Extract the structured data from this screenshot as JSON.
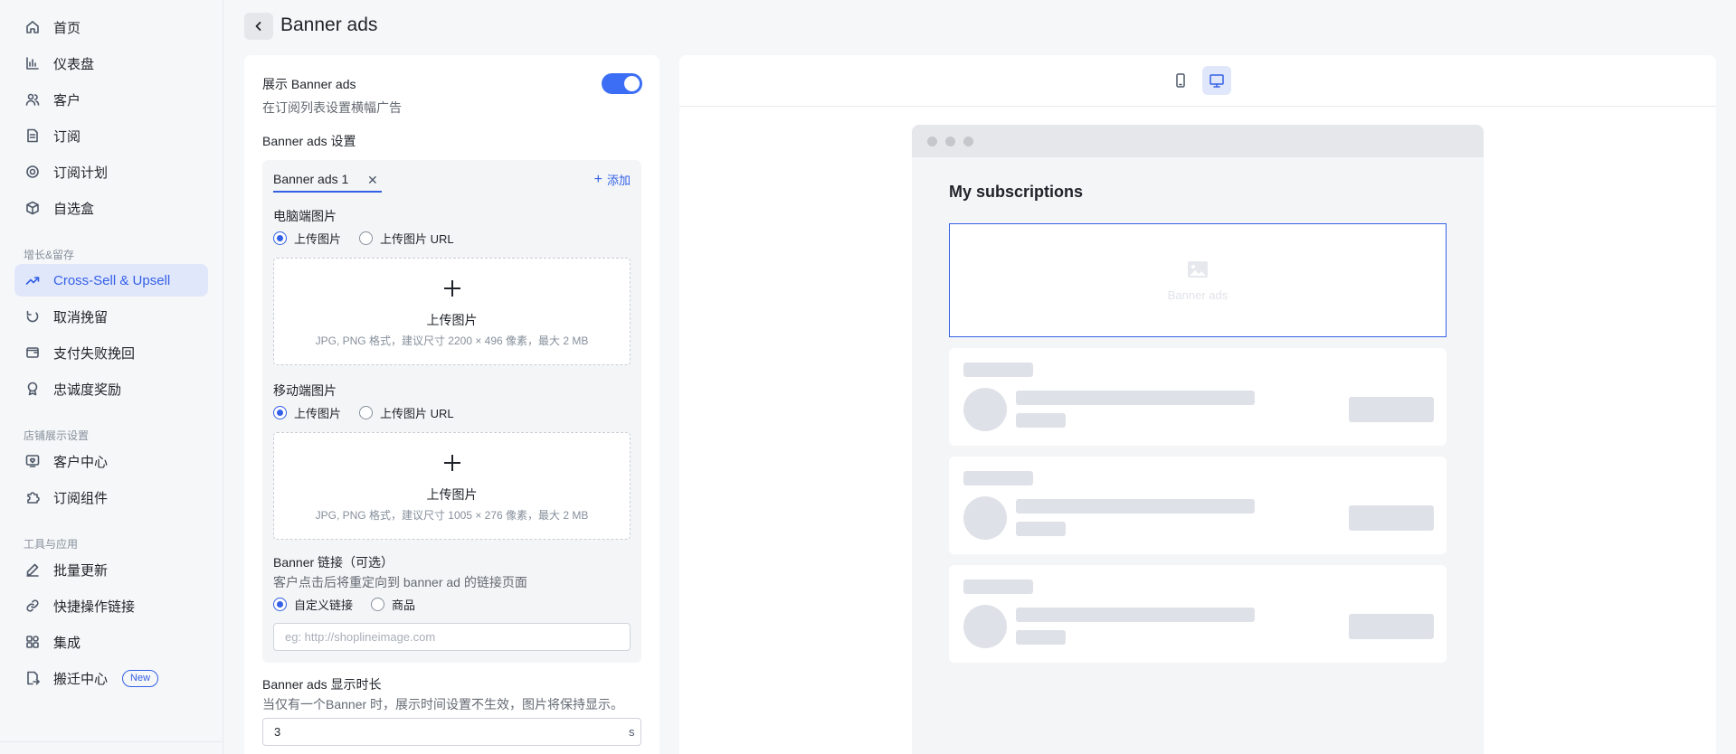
{
  "sidebar": {
    "items": [
      {
        "label": "首页",
        "icon": "home-icon"
      },
      {
        "label": "仪表盘",
        "icon": "bar-chart-icon"
      },
      {
        "label": "客户",
        "icon": "users-icon"
      },
      {
        "label": "订阅",
        "icon": "document-icon"
      },
      {
        "label": "订阅计划",
        "icon": "plan-icon"
      },
      {
        "label": "自选盒",
        "icon": "box-icon"
      }
    ],
    "section_growth": "增长&留存",
    "growth_items": [
      {
        "label": "Cross-Sell & Upsell",
        "icon": "trend-up-icon",
        "active": true
      },
      {
        "label": "取消挽留",
        "icon": "refresh-icon"
      },
      {
        "label": "支付失败挽回",
        "icon": "wallet-icon"
      },
      {
        "label": "忠诚度奖励",
        "icon": "award-icon"
      }
    ],
    "section_store": "店铺展示设置",
    "store_items": [
      {
        "label": "客户中心",
        "icon": "heart-screen-icon"
      },
      {
        "label": "订阅组件",
        "icon": "puzzle-icon"
      }
    ],
    "section_tools": "工具与应用",
    "tool_items": [
      {
        "label": "批量更新",
        "icon": "pen-icon"
      },
      {
        "label": "快捷操作链接",
        "icon": "link-icon"
      },
      {
        "label": "集成",
        "icon": "apps-icon"
      },
      {
        "label": "搬迁中心",
        "icon": "migrate-icon",
        "badge": "New"
      }
    ]
  },
  "header": {
    "title": "Banner ads"
  },
  "settings": {
    "toggle_label": "展示 Banner ads",
    "toggle_desc": "在订阅列表设置横幅广告",
    "toggle_on": true,
    "section_title": "Banner ads 设置",
    "tab_label": "Banner ads 1",
    "add_label": "添加",
    "desktop_image_label": "电脑端图片",
    "mobile_image_label": "移动端图片",
    "radio_upload": "上传图片",
    "radio_url": "上传图片 URL",
    "upload_title": "上传图片",
    "desktop_hint": "JPG, PNG 格式，建议尺寸 2200 × 496 像素，最大 2 MB",
    "mobile_hint": "JPG, PNG 格式，建议尺寸 1005 × 276 像素，最大 2 MB",
    "link_label": "Banner 链接（可选）",
    "link_desc": "客户点击后将重定向到 banner ad 的链接页面",
    "link_custom": "自定义链接",
    "link_product": "商品",
    "link_placeholder": "eg: http://shoplineimage.com",
    "duration_label": "Banner ads 显示时长",
    "duration_desc": "当仅有一个Banner 时，展示时间设置不生效，图片将保持显示。",
    "duration_value": "3",
    "duration_suffix": "s"
  },
  "preview": {
    "subscriptions_title": "My subscriptions",
    "banner_placeholder": "Banner ads",
    "accent": "#3360e6"
  }
}
